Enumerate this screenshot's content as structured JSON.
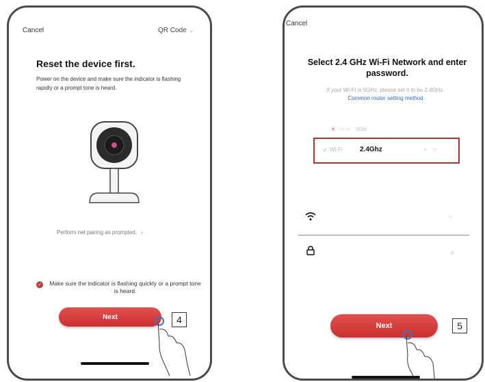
{
  "screen1": {
    "cancel_label": "Cancel",
    "qr_label": "QR Code",
    "title": "Reset the device first.",
    "instruction": "Power on the device and make sure the indicator is flashing rapidly or a prompt tone is heard.",
    "pairing_link": "Perform net pairing as prompted.",
    "checkbox_label": "Make sure the indicator is flashing quickly or a prompt tone is heard.",
    "checkbox_checked": true,
    "next_label": "Next",
    "step_number": "4"
  },
  "screen2": {
    "cancel_label": "Cancel",
    "title": "Select 2.4 GHz Wi-Fi Network and enter password.",
    "hint": "If your Wi-Fi is 5GHz, please set it to be 2.4GHz.",
    "router_link": "Common router setting method",
    "networks": [
      {
        "name": "Wi-Fi",
        "band": "5Ghz",
        "status": "unsupported"
      },
      {
        "name": "Wi-Fi",
        "band": "2.4Ghz",
        "status": "selected"
      }
    ],
    "next_label": "Next",
    "step_number": "5"
  },
  "colors": {
    "accent_red": "#d43d3c",
    "link_blue": "#2a6ab8",
    "highlight_border": "#b03030"
  },
  "icons": [
    "chevron-right-icon",
    "checkbox-icon",
    "wifi-icon",
    "lock-icon",
    "hand-pointer-icon",
    "camera-device-icon",
    "check-icon",
    "x-icon"
  ]
}
